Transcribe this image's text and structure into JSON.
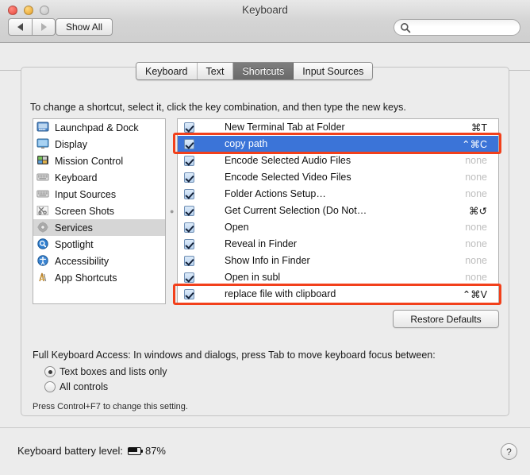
{
  "window": {
    "title": "Keyboard",
    "traffic_lights": [
      "close",
      "minimize",
      "zoom"
    ],
    "nav_back": "back-arrow",
    "nav_forward": "forward-arrow",
    "show_all_label": "Show All",
    "search": {
      "value": "",
      "placeholder": "",
      "icon": "search-icon"
    }
  },
  "tabs": [
    {
      "label": "Keyboard",
      "active": false
    },
    {
      "label": "Text",
      "active": false
    },
    {
      "label": "Shortcuts",
      "active": true
    },
    {
      "label": "Input Sources",
      "active": false
    }
  ],
  "instruction": "To change a shortcut, select it, click the key combination, and then type the new keys.",
  "sidebar": {
    "items": [
      {
        "label": "Launchpad & Dock",
        "icon": "launchpad-icon",
        "selected": false
      },
      {
        "label": "Display",
        "icon": "display-icon",
        "selected": false
      },
      {
        "label": "Mission Control",
        "icon": "mission-control-icon",
        "selected": false
      },
      {
        "label": "Keyboard",
        "icon": "keyboard-icon",
        "selected": false
      },
      {
        "label": "Input Sources",
        "icon": "input-sources-icon",
        "selected": false
      },
      {
        "label": "Screen Shots",
        "icon": "screenshots-icon",
        "selected": false
      },
      {
        "label": "Services",
        "icon": "gear-icon",
        "selected": true
      },
      {
        "label": "Spotlight",
        "icon": "spotlight-icon",
        "selected": false
      },
      {
        "label": "Accessibility",
        "icon": "accessibility-icon",
        "selected": false
      },
      {
        "label": "App Shortcuts",
        "icon": "app-shortcuts-icon",
        "selected": false
      }
    ]
  },
  "shortcut_list": {
    "rows": [
      {
        "checked": true,
        "label": "New Terminal Tab at Folder",
        "shortcut": "⌘T",
        "none": false,
        "selected": false,
        "annotated": false
      },
      {
        "checked": true,
        "label": "copy path",
        "shortcut": "⌃⌘C",
        "none": false,
        "selected": true,
        "annotated": true
      },
      {
        "checked": true,
        "label": "Encode Selected Audio Files",
        "shortcut": "none",
        "none": true,
        "selected": false,
        "annotated": false
      },
      {
        "checked": true,
        "label": "Encode Selected Video Files",
        "shortcut": "none",
        "none": true,
        "selected": false,
        "annotated": false
      },
      {
        "checked": true,
        "label": "Folder Actions Setup…",
        "shortcut": "none",
        "none": true,
        "selected": false,
        "annotated": false
      },
      {
        "checked": true,
        "label": "Get Current Selection (Do Not…",
        "shortcut": "⌘↺",
        "none": false,
        "selected": false,
        "annotated": false
      },
      {
        "checked": true,
        "label": "Open",
        "shortcut": "none",
        "none": true,
        "selected": false,
        "annotated": false
      },
      {
        "checked": true,
        "label": "Reveal in Finder",
        "shortcut": "none",
        "none": true,
        "selected": false,
        "annotated": false
      },
      {
        "checked": true,
        "label": "Show Info in Finder",
        "shortcut": "none",
        "none": true,
        "selected": false,
        "annotated": false
      },
      {
        "checked": true,
        "label": "Open in subl",
        "shortcut": "none",
        "none": true,
        "selected": false,
        "annotated": false
      },
      {
        "checked": true,
        "label": "replace file with clipboard",
        "shortcut": "⌃⌘V",
        "none": false,
        "selected": false,
        "annotated": true
      }
    ]
  },
  "restore_defaults_label": "Restore Defaults",
  "full_keyboard_access": {
    "label": "Full Keyboard Access: In windows and dialogs, press Tab to move keyboard focus between:",
    "options": [
      {
        "label": "Text boxes and lists only",
        "selected": true
      },
      {
        "label": "All controls",
        "selected": false
      }
    ],
    "hint": "Press Control+F7 to change this setting."
  },
  "status_bar": {
    "battery_label": "Keyboard battery level:",
    "battery_icon": "battery-icon",
    "battery_value": "87%",
    "help_label": "?"
  },
  "colors": {
    "selection_blue": "#3b74d8",
    "annotation_red": "#f2401b",
    "sidebar_selected_gray": "#d6d6d6",
    "window_chrome": "#ececec"
  }
}
